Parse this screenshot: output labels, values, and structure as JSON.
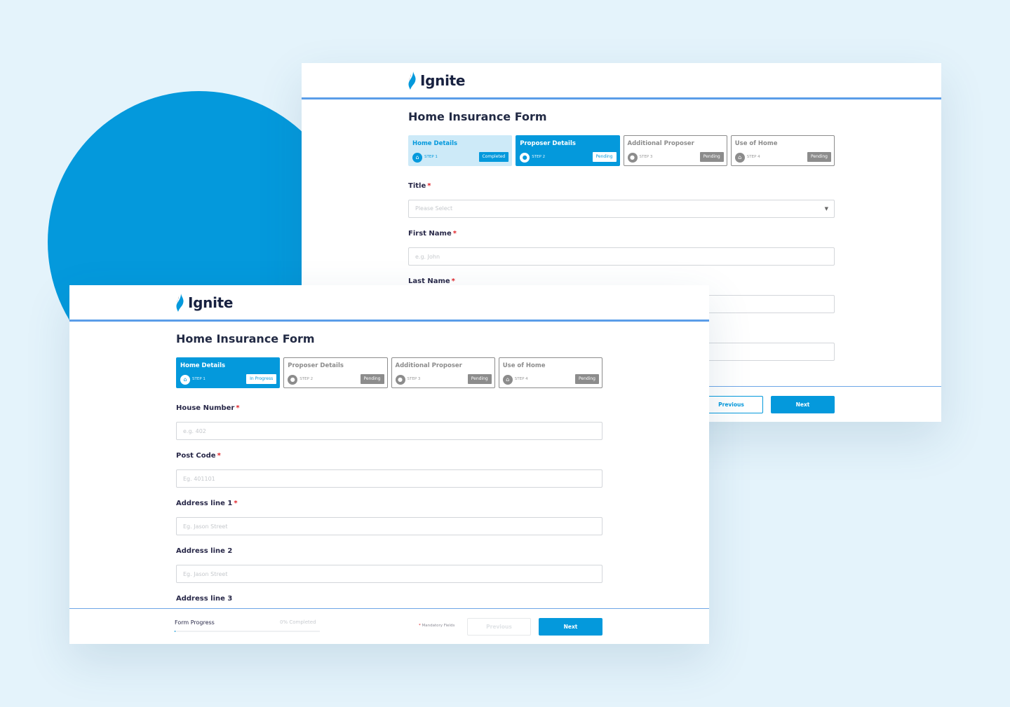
{
  "colors": {
    "accent": "#0499dc",
    "background": "#e4f3fb",
    "header_rule": "#5a9de8",
    "required": "#e0242a"
  },
  "back_window": {
    "brand": "Ignite",
    "form_title": "Home Insurance Form",
    "steps": [
      {
        "title": "Home Details",
        "step": "STEP 1",
        "status": "Completed",
        "icon": "home-icon"
      },
      {
        "title": "Proposer Details",
        "step": "STEP 2",
        "status": "Pending",
        "icon": "user-icon"
      },
      {
        "title": "Additional Proposer",
        "step": "STEP 3",
        "status": "Pending",
        "icon": "users-icon"
      },
      {
        "title": "Use of Home",
        "step": "STEP 4",
        "status": "Pending",
        "icon": "home-icon"
      }
    ],
    "fields": [
      {
        "label": "Title",
        "required": "*",
        "placeholder": "Please Select",
        "type": "select"
      },
      {
        "label": "First Name",
        "required": "*",
        "placeholder": "e.g. John"
      },
      {
        "label": "Last Name",
        "required": "*",
        "placeholder": ""
      }
    ],
    "footer": {
      "previous": "Previous",
      "next": "Next"
    }
  },
  "front_window": {
    "brand": "Ignite",
    "form_title": "Home Insurance Form",
    "steps": [
      {
        "title": "Home Details",
        "step": "STEP 1",
        "status": "In Progress",
        "icon": "home-icon"
      },
      {
        "title": "Proposer Details",
        "step": "STEP 2",
        "status": "Pending",
        "icon": "user-icon"
      },
      {
        "title": "Additional Proposer",
        "step": "STEP 3",
        "status": "Pending",
        "icon": "users-icon"
      },
      {
        "title": "Use of Home",
        "step": "STEP 4",
        "status": "Pending",
        "icon": "home-icon"
      }
    ],
    "fields": [
      {
        "label": "House Number",
        "required": "*",
        "placeholder": "e.g. 402"
      },
      {
        "label": "Post Code",
        "required": "*",
        "placeholder": "Eg. 401101"
      },
      {
        "label": "Address line 1",
        "required": "*",
        "placeholder": "Eg. Jason Street"
      },
      {
        "label": "Address line 2",
        "required": "",
        "placeholder": "Eg. Jason Street"
      },
      {
        "label": "Address line 3",
        "required": "",
        "placeholder": ""
      }
    ],
    "footer": {
      "progress_label": "Form Progress",
      "progress_text": "0% Completed",
      "progress_value": 0,
      "mandatory_star": "*",
      "mandatory_text": "Mandatory Fields",
      "previous": "Previous",
      "next": "Next"
    }
  }
}
